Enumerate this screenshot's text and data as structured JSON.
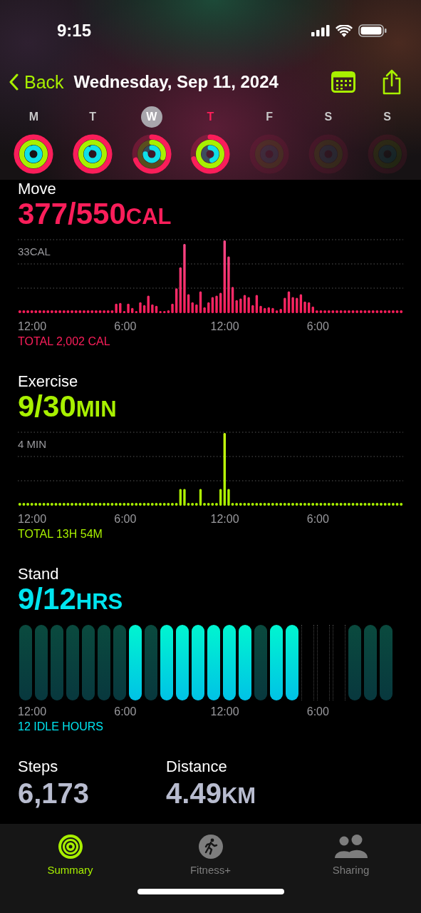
{
  "status_bar": {
    "time": "9:15"
  },
  "nav": {
    "back": "Back",
    "title": "Wednesday, Sep 11, 2024"
  },
  "days": [
    {
      "label": "M",
      "selected": false,
      "today": false,
      "dimmed": false
    },
    {
      "label": "T",
      "selected": false,
      "today": false,
      "dimmed": false
    },
    {
      "label": "W",
      "selected": true,
      "today": false,
      "dimmed": false
    },
    {
      "label": "T",
      "selected": false,
      "today": true,
      "dimmed": false
    },
    {
      "label": "F",
      "selected": false,
      "today": false,
      "dimmed": true
    },
    {
      "label": "S",
      "selected": false,
      "today": false,
      "dimmed": true
    },
    {
      "label": "S",
      "selected": false,
      "today": false,
      "dimmed": true
    }
  ],
  "sections": [
    {
      "kind": "move",
      "title": "Move",
      "value": "377/550",
      "unit": "CAL",
      "color": "#fa1e5a",
      "max_label": "33CAL",
      "x_labels": [
        "12:00",
        "6:00",
        "12:00",
        "6:00"
      ],
      "total": "TOTAL 2,002 CAL"
    },
    {
      "kind": "exercise",
      "title": "Exercise",
      "value": "9/30",
      "unit": "MIN",
      "color": "#a8f000",
      "max_label": "4 MIN",
      "x_labels": [
        "12:00",
        "6:00",
        "12:00",
        "6:00"
      ],
      "total": "TOTAL 13H 54M"
    },
    {
      "kind": "stand",
      "title": "Stand",
      "value": "9/12",
      "unit": "HRS",
      "color": "#00e5f0",
      "x_labels": [
        "12:00",
        "6:00",
        "12:00",
        "6:00"
      ],
      "total": "12 IDLE HOURS",
      "hours": [
        {
          "kind": "idle"
        },
        {
          "kind": "idle"
        },
        {
          "kind": "idle"
        },
        {
          "kind": "idle"
        },
        {
          "kind": "idle"
        },
        {
          "kind": "idle"
        },
        {
          "kind": "idle"
        },
        {
          "kind": "stood"
        },
        {
          "kind": "idle"
        },
        {
          "kind": "stood"
        },
        {
          "kind": "stood"
        },
        {
          "kind": "stood"
        },
        {
          "kind": "stood"
        },
        {
          "kind": "stood"
        },
        {
          "kind": "stood"
        },
        {
          "kind": "idle"
        },
        {
          "kind": "stood"
        },
        {
          "kind": "stood"
        },
        {
          "kind": "empty"
        },
        {
          "kind": "empty"
        },
        {
          "kind": "empty"
        },
        {
          "kind": "idle"
        },
        {
          "kind": "idle"
        },
        {
          "kind": "idle"
        }
      ]
    }
  ],
  "stats": [
    {
      "label": "Steps",
      "value": "6,173"
    },
    {
      "label": "Distance",
      "value": "4.49",
      "unit": "KM"
    }
  ],
  "tabs": [
    {
      "kind": "summary",
      "label": "Summary",
      "selected": true
    },
    {
      "kind": "fitness",
      "label": "Fitness+",
      "selected": false
    },
    {
      "kind": "sharing",
      "label": "Sharing",
      "selected": false
    }
  ]
}
